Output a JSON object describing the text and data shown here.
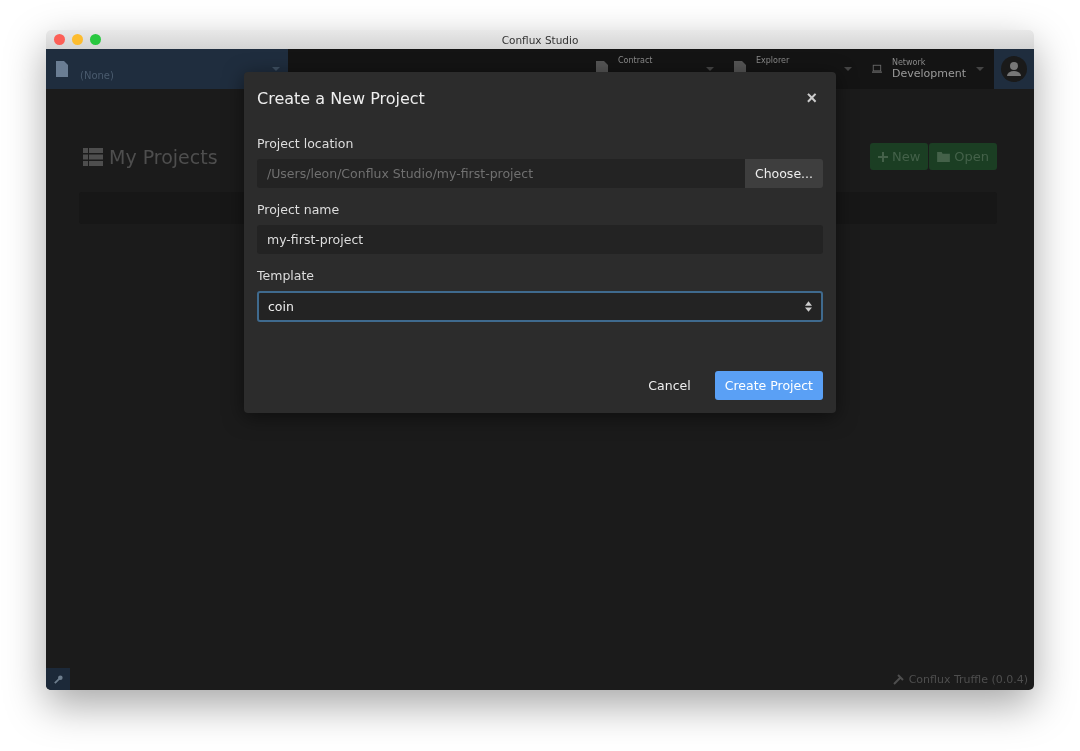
{
  "window": {
    "title": "Conflux Studio"
  },
  "navbar": {
    "project": {
      "value": "(None)"
    },
    "contract": {
      "label": "Contract"
    },
    "explorer": {
      "label": "Explorer"
    },
    "network": {
      "label": "Network",
      "value": "Development"
    }
  },
  "page": {
    "title": "My Projects",
    "buttons": [
      "New",
      "Open"
    ]
  },
  "dialog": {
    "title": "Create a New Project",
    "close": "×",
    "fields": [
      {
        "kind": "path",
        "label": "Project location",
        "placeholder": "/Users/leon/Conflux Studio/my-first-project",
        "button": "Choose..."
      },
      {
        "kind": "text",
        "label": "Project name",
        "value": "my-first-project"
      },
      {
        "kind": "select",
        "label": "Template",
        "value": "coin",
        "focused": true
      }
    ],
    "cancel": "Cancel",
    "submit": "Create Project"
  },
  "status_bar": {
    "version": "Conflux Truffle (0.0.4)"
  }
}
